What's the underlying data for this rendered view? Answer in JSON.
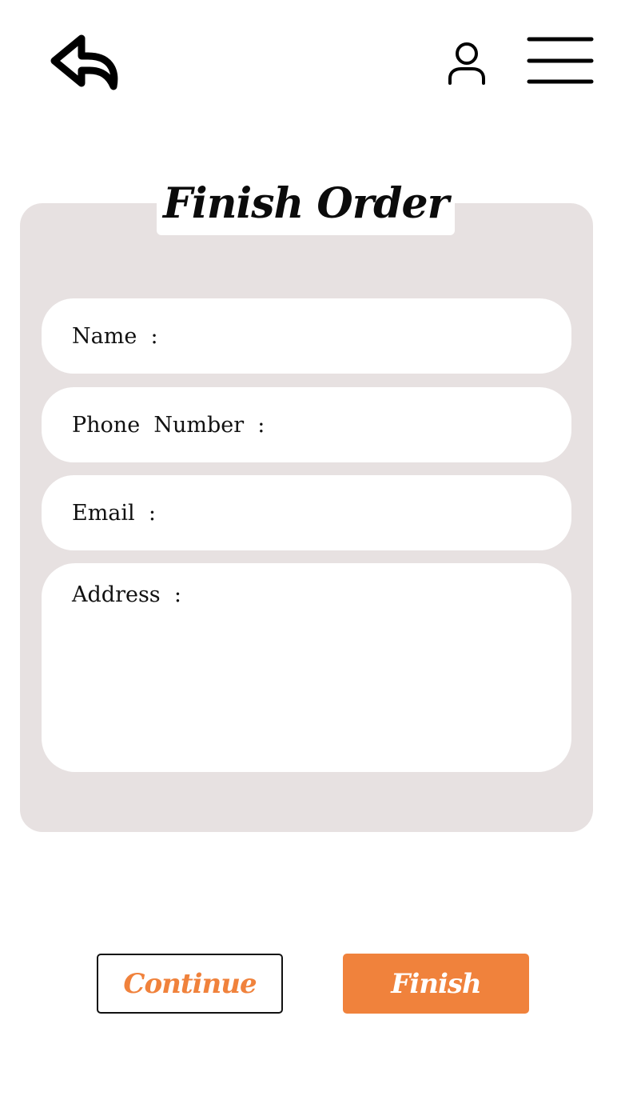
{
  "header": {
    "back_icon": "back-arrow-icon",
    "user_icon": "user-icon",
    "menu_icon": "hamburger-menu-icon"
  },
  "card": {
    "title": "Finish Order",
    "fields": {
      "name_label": "Name  :",
      "phone_label": "Phone  Number  :",
      "email_label": "Email  :",
      "address_label": "Address  :"
    }
  },
  "actions": {
    "continue_label": "Continue",
    "finish_label": "Finish"
  },
  "colors": {
    "accent": "#f0823c",
    "card_background": "#e7e1e1",
    "text": "#111111"
  }
}
